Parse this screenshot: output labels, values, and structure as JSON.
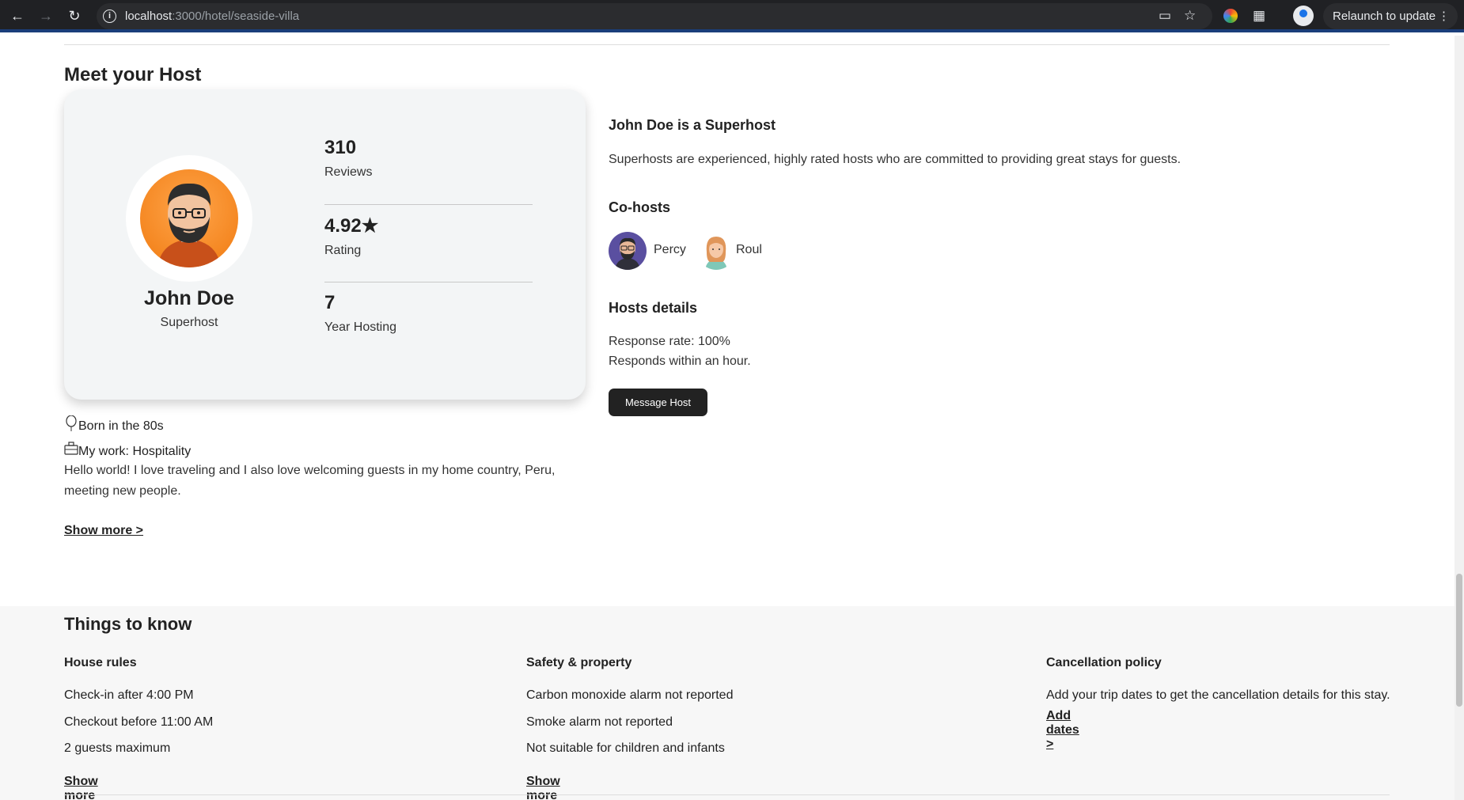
{
  "browser": {
    "url_host": "localhost",
    "url_path": ":3000/hotel/seaside-villa",
    "relaunch_label": "Relaunch to update"
  },
  "host_section": {
    "title": "Meet your Host",
    "name": "John Doe",
    "role": "Superhost",
    "stats": [
      {
        "value": "310",
        "label": "Reviews"
      },
      {
        "value": "4.92★",
        "label": "Rating"
      },
      {
        "value": "7",
        "label": "Year Hosting"
      }
    ],
    "facts": [
      {
        "icon": "balloon-icon",
        "text": "Born in the 80s"
      },
      {
        "icon": "briefcase-icon",
        "text": "My work: Hospitality"
      }
    ],
    "bio": "Hello world! I love traveling and I also love welcoming guests in my home country, Peru, meeting new people.",
    "show_more": "Show more >"
  },
  "superhost": {
    "title": "John Doe is a Superhost",
    "description": "Superhosts are experienced, highly rated hosts who are committed to providing great stays for guests."
  },
  "cohosts": {
    "title": "Co-hosts",
    "items": [
      {
        "name": "Percy"
      },
      {
        "name": "Roul"
      }
    ]
  },
  "host_details": {
    "title": "Hosts details",
    "response_rate": "Response rate: 100%",
    "response_time": "Responds within an hour.",
    "message_button": "Message Host"
  },
  "things_to_know": {
    "title": "Things to know",
    "columns": [
      {
        "heading": "House rules",
        "items": [
          "Check-in after 4:00 PM",
          "Checkout before 11:00 AM",
          "2 guests maximum"
        ],
        "link": "Show more >"
      },
      {
        "heading": "Safety & property",
        "items": [
          "Carbon monoxide alarm not reported",
          "Smoke alarm not reported",
          "Not suitable for children and infants"
        ],
        "link": "Show more >"
      },
      {
        "heading": "Cancellation policy",
        "items": [
          "Add your trip dates to get the cancellation details for this stay."
        ],
        "link": "Add dates >"
      }
    ]
  }
}
